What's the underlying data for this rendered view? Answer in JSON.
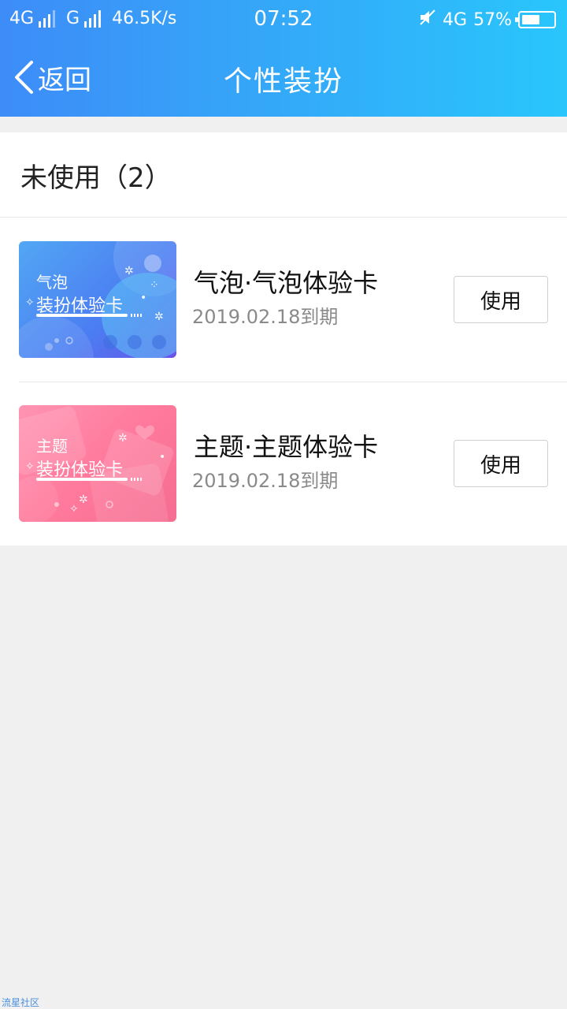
{
  "status_bar": {
    "network_1": "4G",
    "network_2": "G",
    "speed": "46.5K/s",
    "time": "07:52",
    "network_3": "4G",
    "battery": "57%",
    "battery_level": 0.57
  },
  "nav": {
    "back_label": "返回",
    "title": "个性装扮"
  },
  "section": {
    "title": "未使用（2）"
  },
  "items": [
    {
      "thumb_line1": "气泡",
      "thumb_line2": "装扮体验卡",
      "name": "气泡·气泡体验卡",
      "expire": "2019.02.18到期",
      "button": "使用"
    },
    {
      "thumb_line1": "主题",
      "thumb_line2": "装扮体验卡",
      "name": "主题·主题体验卡",
      "expire": "2019.02.18到期",
      "button": "使用"
    }
  ],
  "watermark": "流星社区",
  "colors": {
    "header_start": "#3d8cf8",
    "header_end": "#29c6fc",
    "card_blue": "#4b7df2",
    "card_pink": "#ff7a9c"
  }
}
